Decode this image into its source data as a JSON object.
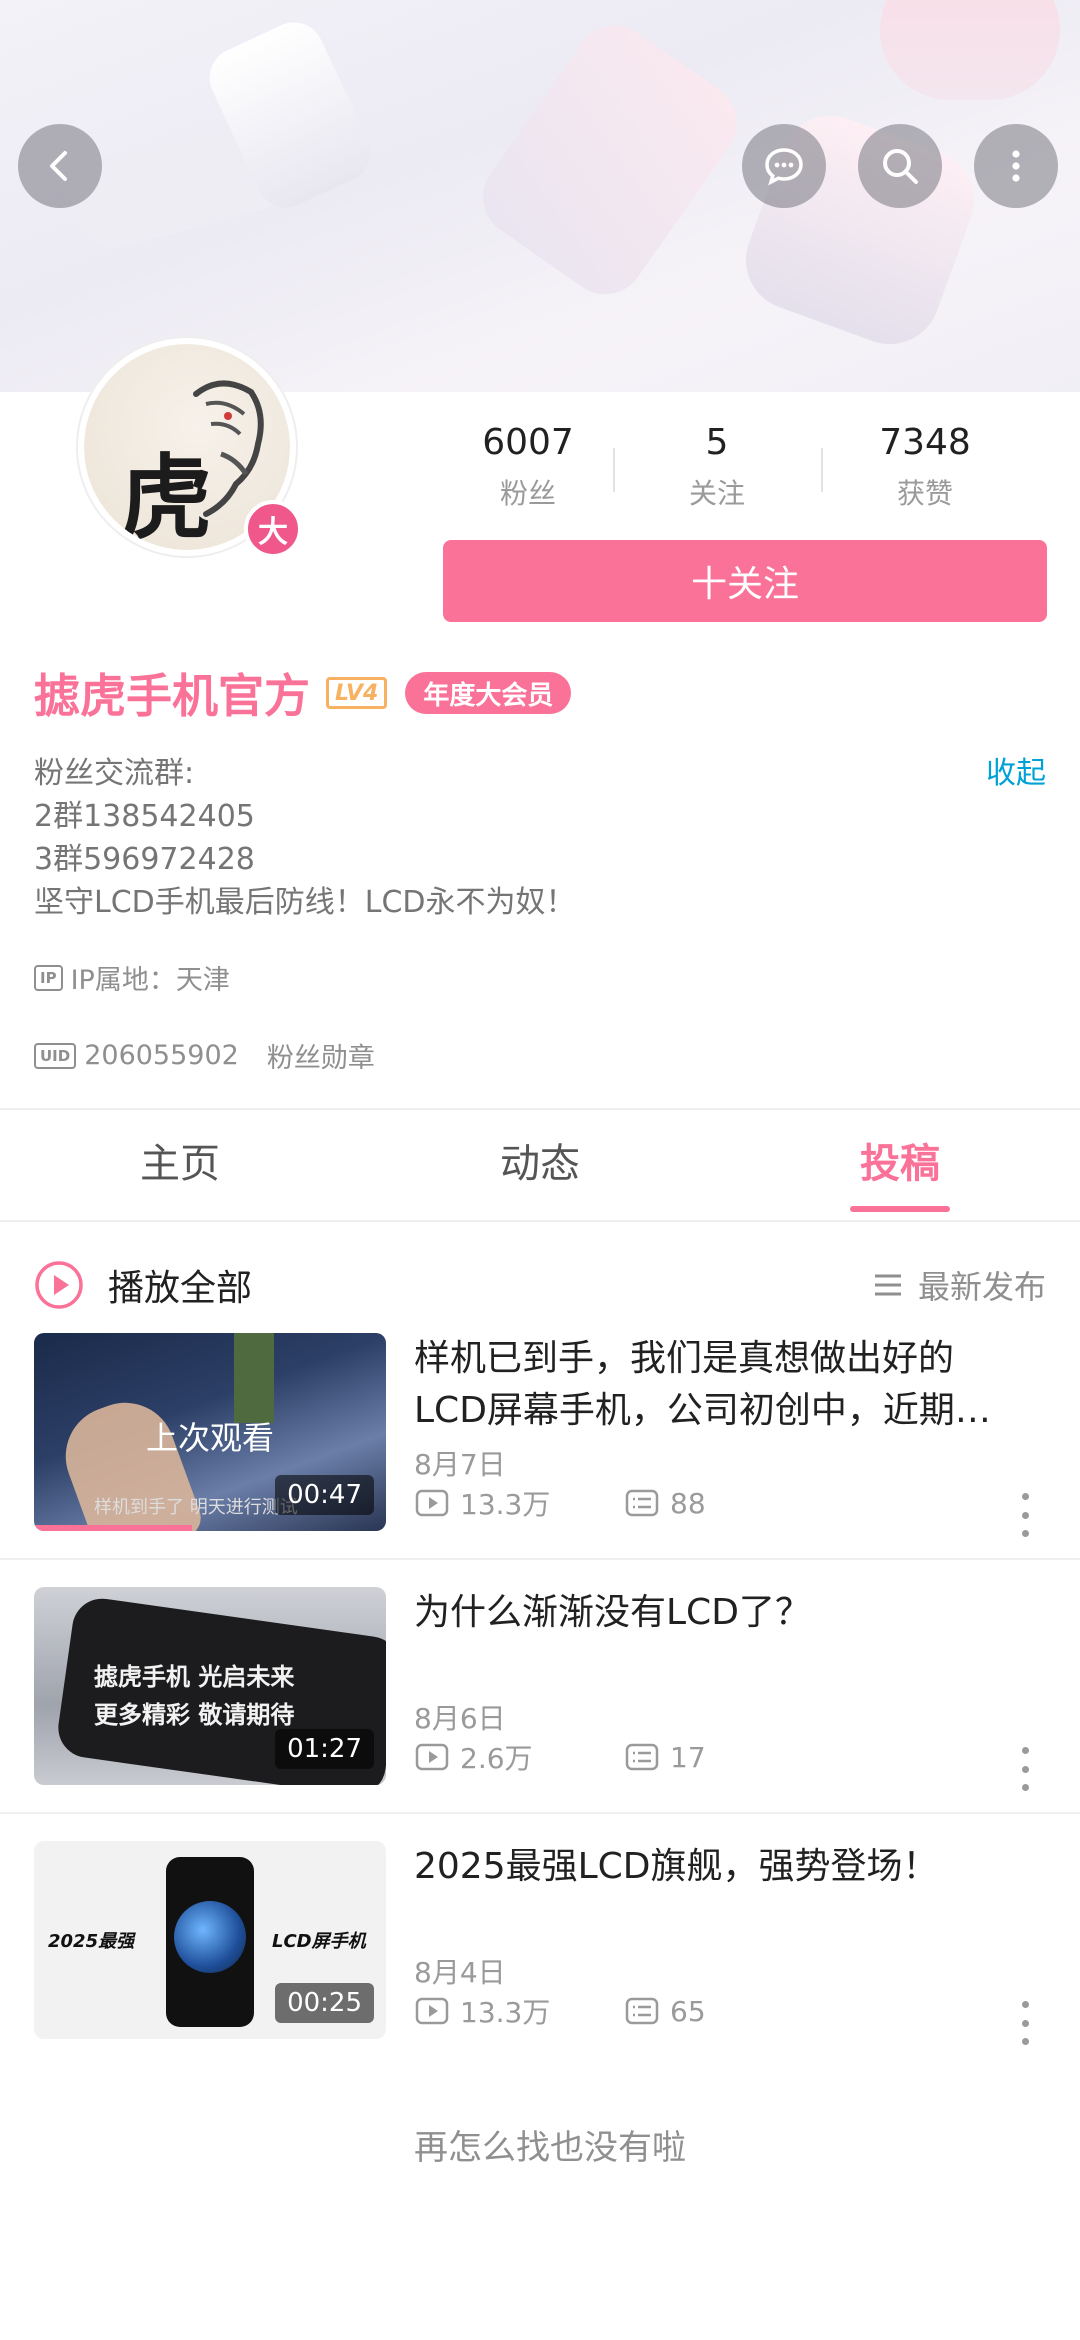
{
  "header": {
    "back_icon": "chevron-left-icon",
    "actions": [
      "chat-bubble-icon",
      "search-icon",
      "more-vertical-icon"
    ]
  },
  "profile": {
    "avatar_text": "虎",
    "avatar_badge": "大",
    "stats": [
      {
        "value": "6007",
        "label": "粉丝"
      },
      {
        "value": "5",
        "label": "关注"
      },
      {
        "value": "7348",
        "label": "获赞"
      }
    ],
    "follow_label": "十关注",
    "name": "摅虎手机官方",
    "level": "LV4",
    "vip_label": "年度大会员",
    "bio_lines": [
      "粉丝交流群:",
      "2群138542405",
      "3群596972428",
      "坚守LCD手机最后防线！LCD永不为奴！"
    ],
    "collapse_label": "收起",
    "ip_tag": "IP",
    "ip_location": "IP属地：天津",
    "uid_tag": "UID",
    "uid": "206055902",
    "fan_medal": "粉丝勋章"
  },
  "tabs": [
    {
      "label": "主页",
      "active": false
    },
    {
      "label": "动态",
      "active": false
    },
    {
      "label": "投稿",
      "active": true
    }
  ],
  "list_header": {
    "play_all": "播放全部",
    "sort": "最新发布"
  },
  "videos": [
    {
      "title": "样机已到手，我们是真想做出好的LCD屏幕手机，公司初创中，近期…",
      "date": "8月7日",
      "views": "13.3万",
      "comments": "88",
      "duration": "00:47",
      "overlay": "上次观看",
      "thumb_caption": "样机到手了 明天进行测试",
      "watch_progress": 0.45
    },
    {
      "title": "为什么渐渐没有LCD了？",
      "date": "8月6日",
      "views": "2.6万",
      "comments": "17",
      "duration": "01:27",
      "thumb_caption_1": "摅虎手机 光启未来",
      "thumb_caption_2": "更多精彩 敬请期待"
    },
    {
      "title": "2025最强LCD旗舰，强势登场！",
      "date": "8月4日",
      "views": "13.3万",
      "comments": "65",
      "duration": "00:25",
      "thumb_left": "2025最强",
      "thumb_right": "LCD屏手机"
    }
  ],
  "end_text": "再怎么找也没有啦",
  "colors": {
    "accent": "#fb7299",
    "link": "#00a1d6",
    "vip_gold": "#f7b160"
  }
}
